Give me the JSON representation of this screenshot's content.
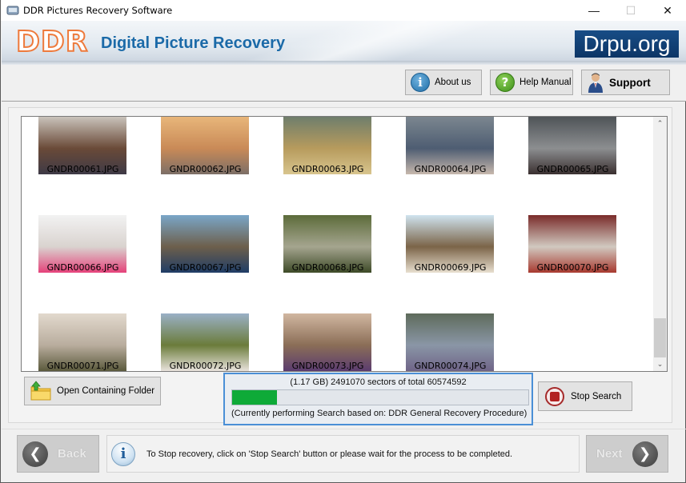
{
  "window": {
    "title": "DDR Pictures Recovery Software",
    "controls": {
      "minimize": "—",
      "maximize": "☐",
      "close": "✕"
    }
  },
  "banner": {
    "logo": "DDR",
    "title": "Digital Picture Recovery",
    "brand": "Drpu.org"
  },
  "toolbar": {
    "about_label": "About us",
    "help_label": "Help Manual",
    "support_label": "Support",
    "icons": {
      "about": "info-icon",
      "help": "question-icon",
      "support": "support-person-icon"
    }
  },
  "gallery": {
    "items": [
      {
        "name": "GNDR00061.JPG",
        "colors": [
          "#c9c3bb",
          "#6a4a38",
          "#3e3a46"
        ]
      },
      {
        "name": "GNDR00062.JPG",
        "colors": [
          "#e8b67a",
          "#c98a57",
          "#7c6f67"
        ]
      },
      {
        "name": "GNDR00063.JPG",
        "colors": [
          "#6f7e6c",
          "#b79b5d",
          "#d8c58e"
        ]
      },
      {
        "name": "GNDR00064.JPG",
        "colors": [
          "#7b868f",
          "#4e5d72",
          "#c7b8ad"
        ]
      },
      {
        "name": "GNDR00065.JPG",
        "colors": [
          "#4f5458",
          "#8c8e90",
          "#3a3030"
        ]
      },
      {
        "name": "GNDR00066.JPG",
        "colors": [
          "#f2f2f2",
          "#d9d3cf",
          "#e5427a"
        ]
      },
      {
        "name": "GNDR00067.JPG",
        "colors": [
          "#7aa6c8",
          "#6d5f4b",
          "#1f3d66"
        ]
      },
      {
        "name": "GNDR00068.JPG",
        "colors": [
          "#5c6b3a",
          "#a5a58f",
          "#3d4a27"
        ]
      },
      {
        "name": "GNDR00069.JPG",
        "colors": [
          "#cfe3ef",
          "#7b6448",
          "#e8dfcf"
        ]
      },
      {
        "name": "GNDR00070.JPG",
        "colors": [
          "#7a2b2a",
          "#d1c9c0",
          "#a8392f"
        ]
      },
      {
        "name": "GNDR00071.JPG",
        "colors": [
          "#e2d9cd",
          "#b9ad9e",
          "#5b5a3c"
        ]
      },
      {
        "name": "GNDR00072.JPG",
        "colors": [
          "#9ab0c6",
          "#6b7c3a",
          "#e9e3dc"
        ]
      },
      {
        "name": "GNDR00073.JPG",
        "colors": [
          "#d1b7a1",
          "#8b6e57",
          "#5b3c6f"
        ]
      },
      {
        "name": "GNDR00074.JPG",
        "colors": [
          "#5e6b5b",
          "#8a96a6",
          "#6f6488"
        ]
      }
    ]
  },
  "scrollbar": {
    "up": "⌃",
    "down": "⌄",
    "position_fraction": 0.85
  },
  "actions": {
    "open_folder_label": "Open Containing Folder",
    "stop_label": "Stop Search"
  },
  "progress": {
    "status": "(1.17 GB) 2491070  sectors  of  total 60574592",
    "sectors_done": 2491070,
    "sectors_total": 60574592,
    "fill_fraction": 0.15,
    "description": "(Currently performing Search based on:  DDR General Recovery Procedure)",
    "fill_color": "#0eaa38"
  },
  "footer": {
    "back_label": "Back",
    "next_label": "Next",
    "info_text": "To Stop recovery, click on 'Stop Search' button or please wait for the process to be completed."
  }
}
